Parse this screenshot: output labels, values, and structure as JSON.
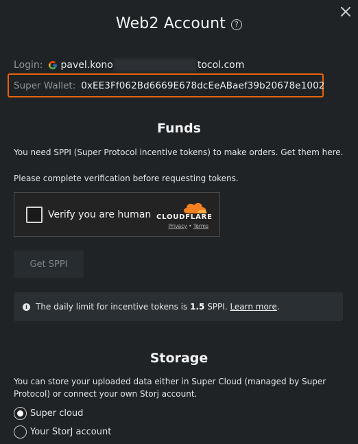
{
  "header": {
    "title": "Web2 Account",
    "help_icon": "?",
    "close_icon": "close-icon"
  },
  "account": {
    "login_label": "Login:",
    "login_provider_icon": "google-icon",
    "login_prefix": "pavel.kono",
    "login_suffix": "tocol.com",
    "wallet_label": "Super Wallet:",
    "wallet_address": "0xEE3Ff062Bd6669E678dcEeABaef39b20678e1002"
  },
  "funds": {
    "title": "Funds",
    "text1": "You need SPPI (Super Protocol incentive tokens) to make orders. Get them here.",
    "text2": "Please complete verification before requesting tokens.",
    "captcha": {
      "label": "Verify you are human",
      "brand": "CLOUDFLARE",
      "privacy": "Privacy",
      "separator": "•",
      "terms": "Terms"
    },
    "button_label": "Get SPPI",
    "info": {
      "icon": "i",
      "text_before": "The daily limit for incentive tokens is ",
      "amount": "1.5",
      "text_after": " SPPI. ",
      "link": "Learn more",
      "end": "."
    }
  },
  "storage": {
    "title": "Storage",
    "text": "You can store your uploaded data either in Super Cloud (managed by Super Protocol) or connect your own Storj account.",
    "options": [
      {
        "label": "Super cloud",
        "selected": true
      },
      {
        "label": "Your StorJ account",
        "selected": false
      }
    ]
  },
  "colors": {
    "background": "#1f2326",
    "highlight_border": "#e8630a",
    "cloudflare_orange": "#f38020"
  }
}
